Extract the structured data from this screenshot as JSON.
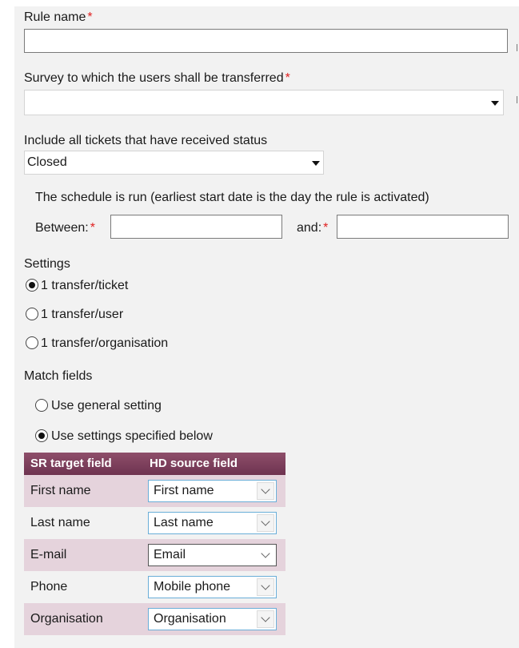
{
  "form": {
    "rule_name": {
      "label": "Rule name",
      "required_mark": "*",
      "value": ""
    },
    "survey": {
      "label": "Survey to which the users shall be transferred",
      "required_mark": "*",
      "selected": ""
    },
    "include_status": {
      "label": "Include all tickets that have received status",
      "selected": "Closed"
    },
    "schedule": {
      "description": "The schedule is run (earliest start date is the day the rule is activated)",
      "between_label": "Between:",
      "and_label": "and:",
      "required_mark": "*",
      "between_value": "",
      "and_value": ""
    },
    "settings": {
      "heading": "Settings",
      "options": [
        {
          "label": "1 transfer/ticket",
          "checked": true
        },
        {
          "label": "1 transfer/user",
          "checked": false
        },
        {
          "label": "1 transfer/organisation",
          "checked": false
        }
      ]
    },
    "match_fields": {
      "heading": "Match fields",
      "options": [
        {
          "label": "Use general setting",
          "checked": false
        },
        {
          "label": "Use settings specified below",
          "checked": true
        }
      ]
    },
    "mapping": {
      "header_colors": [
        "#8e4f6a",
        "#6e3350"
      ],
      "columns": [
        "SR target field",
        "HD source field"
      ],
      "rows": [
        {
          "target": "First name",
          "source": "First name"
        },
        {
          "target": "Last name",
          "source": "Last name"
        },
        {
          "target": "E-mail",
          "source": "Email"
        },
        {
          "target": "Phone",
          "source": "Mobile phone"
        },
        {
          "target": "Organisation",
          "source": "Organisation"
        }
      ]
    }
  },
  "icons": {
    "dropdown": "caret-down-icon",
    "select": "chevron-down-icon",
    "radio_checked": "radio-checked",
    "radio_unchecked": "radio-unchecked"
  },
  "colors": {
    "required": "#e02020",
    "panel_bg": "#f2f2f2",
    "row_alt": "#e5d3dc",
    "focus_border": "#6aaed8"
  }
}
